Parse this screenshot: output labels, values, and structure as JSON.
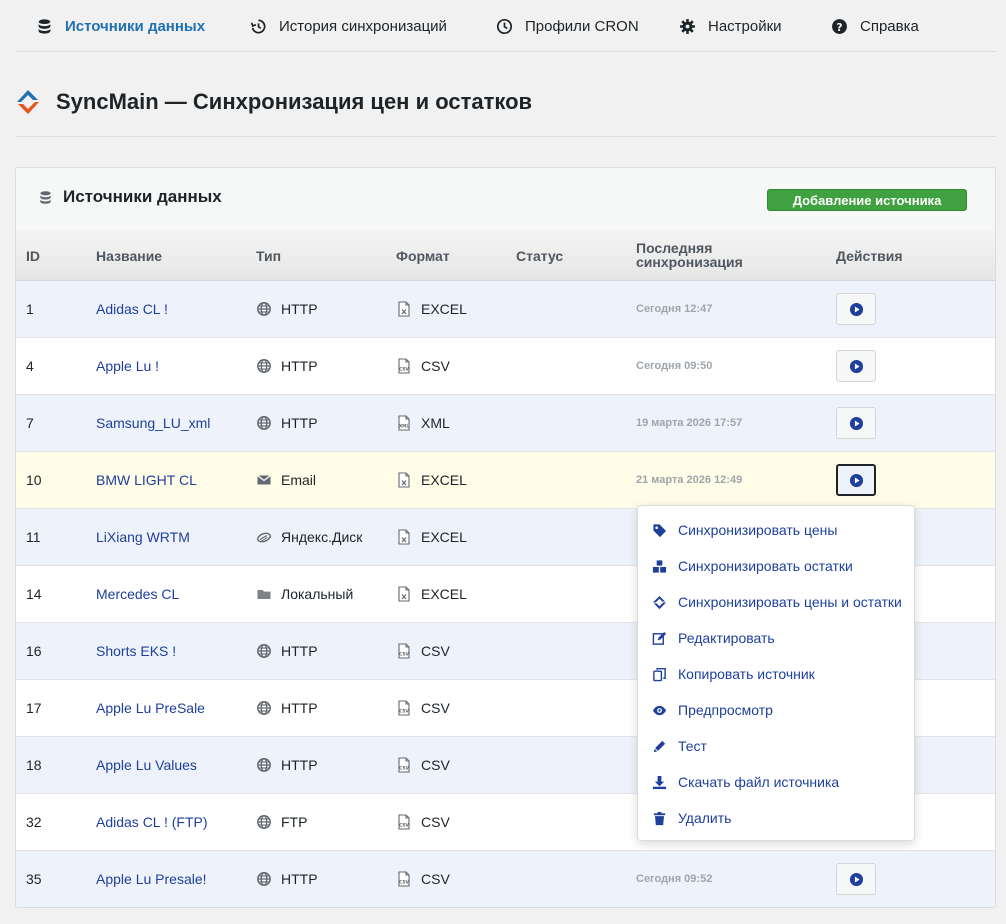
{
  "nav": [
    {
      "label": "Источники данных",
      "icon": "database-icon",
      "active": true
    },
    {
      "label": "История синхронизаций",
      "icon": "history-icon"
    },
    {
      "label": "Профили CRON",
      "icon": "clock-icon"
    },
    {
      "label": "Настройки",
      "icon": "gear-icon"
    },
    {
      "label": "Справка",
      "icon": "question-icon"
    }
  ],
  "page": {
    "title": "SyncMain — Синхронизация цен и остатков",
    "logo": "sync-logo-icon"
  },
  "card": {
    "title": "Источники данных",
    "add_button": "Добавление источника"
  },
  "columns": {
    "id": "ID",
    "name": "Название",
    "type": "Тип",
    "format": "Формат",
    "status": "Статус",
    "last_sync_1": "Последняя",
    "last_sync_2": "синхронизация",
    "actions": "Действия"
  },
  "rows": [
    {
      "id": "1",
      "name": "Adidas CL !",
      "type": "HTTP",
      "type_icon": "globe-icon",
      "format": "EXCEL",
      "format_icon": "excel-file-icon",
      "status": "",
      "last_sync": "Сегодня 12:47",
      "action": true
    },
    {
      "id": "4",
      "name": "Apple Lu !",
      "type": "HTTP",
      "type_icon": "globe-icon",
      "format": "CSV",
      "format_icon": "csv-file-icon",
      "status": "",
      "last_sync": "Сегодня 09:50",
      "action": true
    },
    {
      "id": "7",
      "name": "Samsung_LU_xml",
      "type": "HTTP",
      "type_icon": "globe-icon",
      "format": "XML",
      "format_icon": "xml-file-icon",
      "status": "",
      "last_sync": "19 марта 2026 17:57",
      "action": true
    },
    {
      "id": "10",
      "name": "BMW LIGHT CL",
      "type": "Email",
      "type_icon": "envelope-icon",
      "format": "EXCEL",
      "format_icon": "excel-file-icon",
      "status": "",
      "last_sync": "21 марта 2026 12:49",
      "action": true,
      "focus": true
    },
    {
      "id": "11",
      "name": "LiXiang WRTM",
      "type": "Яндекс.Диск",
      "type_icon": "yandex-disk-icon",
      "format": "EXCEL",
      "format_icon": "excel-file-icon",
      "status": "",
      "last_sync": "",
      "action": false
    },
    {
      "id": "14",
      "name": "Mercedes CL",
      "type": "Локальный",
      "type_icon": "folder-icon",
      "format": "EXCEL",
      "format_icon": "excel-file-icon",
      "status": "",
      "last_sync": "",
      "action": false
    },
    {
      "id": "16",
      "name": "Shorts EKS !",
      "type": "HTTP",
      "type_icon": "globe-icon",
      "format": "CSV",
      "format_icon": "csv-file-icon",
      "status": "",
      "last_sync": "",
      "action": false
    },
    {
      "id": "17",
      "name": "Apple Lu PreSale",
      "type": "HTTP",
      "type_icon": "globe-icon",
      "format": "CSV",
      "format_icon": "csv-file-icon",
      "status": "",
      "last_sync": "",
      "action": false
    },
    {
      "id": "18",
      "name": "Apple Lu Values",
      "type": "HTTP",
      "type_icon": "globe-icon",
      "format": "CSV",
      "format_icon": "csv-file-icon",
      "status": "",
      "last_sync": "",
      "action": false
    },
    {
      "id": "32",
      "name": "Adidas CL ! (FTP)",
      "type": "FTP",
      "type_icon": "globe-icon",
      "format": "CSV",
      "format_icon": "csv-file-icon",
      "status": "",
      "last_sync": "",
      "action": false
    },
    {
      "id": "35",
      "name": "Apple Lu Presale!",
      "type": "HTTP",
      "type_icon": "globe-icon",
      "format": "CSV",
      "format_icon": "csv-file-icon",
      "status": "",
      "last_sync": "Сегодня 09:52",
      "action": true
    }
  ],
  "menu": [
    {
      "label": "Синхронизировать цены",
      "icon": "tag-icon"
    },
    {
      "label": "Синхронизировать остатки",
      "icon": "boxes-icon"
    },
    {
      "label": "Синхронизировать цены и остатки",
      "icon": "sync-both-icon"
    },
    {
      "label": "Редактировать",
      "icon": "edit-icon"
    },
    {
      "label": "Копировать источник",
      "icon": "copy-icon"
    },
    {
      "label": "Предпросмотр",
      "icon": "eye-icon"
    },
    {
      "label": "Тест",
      "icon": "pencil-icon"
    },
    {
      "label": "Скачать файл источника",
      "icon": "download-icon"
    },
    {
      "label": "Удалить",
      "icon": "trash-icon"
    }
  ],
  "colors": {
    "accent": "#2271b1",
    "link": "#1e3f9c",
    "success": "#3fa13f",
    "highlight": "#fffde7",
    "row_alt": "#eef3fb"
  }
}
